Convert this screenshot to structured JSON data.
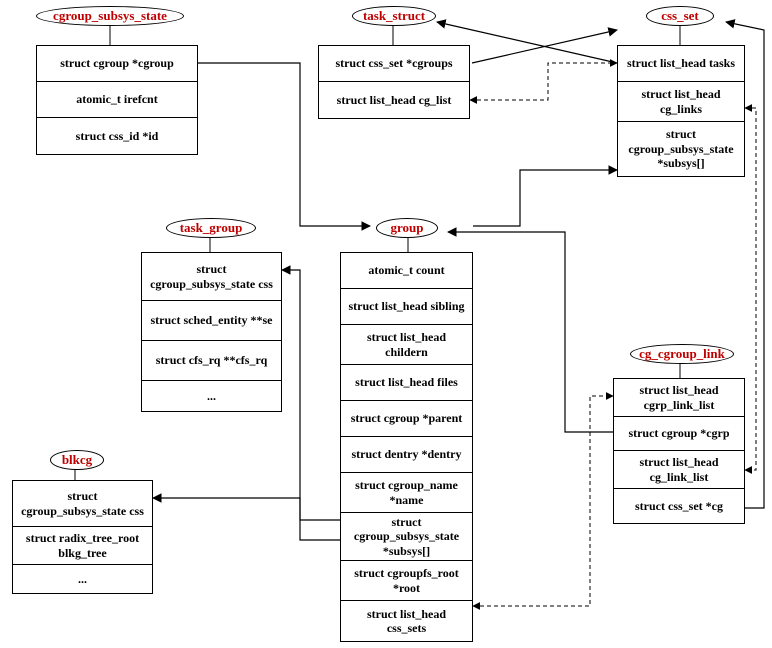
{
  "structs": {
    "cgroup_subsys_state": {
      "title": "cgroup_subsys_state",
      "fields": [
        "struct cgroup *cgroup",
        "atomic_t irefcnt",
        "struct css_id *id"
      ]
    },
    "task_struct": {
      "title": "task_struct",
      "fields": [
        "struct css_set *cgroups",
        "struct list_head cg_list"
      ]
    },
    "css_set": {
      "title": "css_set",
      "fields": [
        "struct list_head tasks",
        "struct list_head cg_links",
        "struct cgroup_subsys_state *subsys[]"
      ]
    },
    "task_group": {
      "title": "task_group",
      "fields": [
        "struct cgroup_subsys_state css",
        "struct sched_entity **se",
        "struct cfs_rq **cfs_rq",
        "..."
      ]
    },
    "group": {
      "title": "group",
      "fields": [
        "atomic_t count",
        "struct list_head sibling",
        "struct list_head childern",
        "struct list_head files",
        "struct cgroup *parent",
        "struct dentry *dentry",
        "struct cgroup_name *name",
        "struct cgroup_subsys_state *subsys[]",
        "struct cgroupfs_root *root",
        "struct list_head css_sets"
      ]
    },
    "cg_cgroup_link": {
      "title": "cg_cgroup_link",
      "fields": [
        "struct list_head cgrp_link_list",
        "struct cgroup *cgrp",
        "struct list_head cg_link_list",
        "struct css_set *cg"
      ]
    },
    "blkcg": {
      "title": "blkcg",
      "fields": [
        "struct cgroup_subsys_state css",
        "struct radix_tree_root blkg_tree",
        "..."
      ]
    }
  }
}
